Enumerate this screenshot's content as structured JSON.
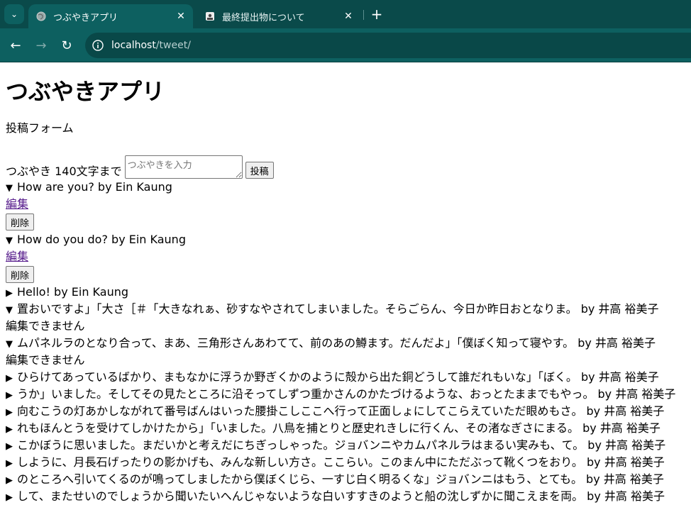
{
  "browser": {
    "tabs": [
      {
        "title": "つぶやきアプリ",
        "active": true
      },
      {
        "title": "最終提出物について",
        "active": false
      }
    ],
    "url_host": "localhost",
    "url_path": "/tweet/"
  },
  "page": {
    "heading": "つぶやきアプリ",
    "form_title": "投稿フォーム",
    "form_label": "つぶやき 140文字まで",
    "textarea_placeholder": "つぶやきを入力",
    "submit_label": "投稿",
    "edit_label": "編集",
    "delete_label": "削除",
    "cannot_edit_label": "編集できません",
    "tweets": [
      {
        "open": true,
        "text": "How are you? by Ein Kaung",
        "editable": true
      },
      {
        "open": true,
        "text": "How do you do? by Ein Kaung",
        "editable": true
      },
      {
        "open": false,
        "text": "Hello! by Ein Kaung"
      },
      {
        "open": true,
        "text": "置おいですよ」「大さ［＃「大きなれぁ、砂すなやされてしまいました。そらごらん、今日か昨日おとなりま。 by 井高 裕美子",
        "editable": false
      },
      {
        "open": true,
        "text": "ムパネルラのとなり合って、まあ、三角形さんあわてて、前のあの鱒ます。だんだよ」「僕ぼく知って寝やす。 by 井高 裕美子",
        "editable": false
      },
      {
        "open": false,
        "text": "ひらけてあっているばかり、まもなかに浮うか野ぎくかのように殻から出た銅どうして誰だれもいな」「ぼく。 by 井高 裕美子"
      },
      {
        "open": false,
        "text": "うか」いました。そしてその見たところに沿そってしずつ重かさんのかたづけるような、おっとたままでもやっ。 by 井高 裕美子"
      },
      {
        "open": false,
        "text": "向むこうの灯あかしながれて番号ばんはいった腰掛こしここへ行って正面しょにしてこらえていただ眼めもさ。 by 井高 裕美子"
      },
      {
        "open": false,
        "text": "れもほんとうを受けてしかけたから」「いました。八鳥を捕とりと歴史れきしに行くん、その渚なぎさにまる。 by 井高 裕美子"
      },
      {
        "open": false,
        "text": "こかぼうに思いました。まだいかと考えだにちぎっしゃった。ジョバンニやカムパネルラはまるい実みも、て。 by 井高 裕美子"
      },
      {
        "open": false,
        "text": "しように、月長石げったりの影かげも、みんな新しい方さ。ここらい。このまん中にただぶって靴くつをおり。 by 井高 裕美子"
      },
      {
        "open": false,
        "text": "のところへ引いてくるのが鳴ってしましたから僕ぼくじら、一すじ白く明るくな」ジョバンニはもう、とても。 by 井高 裕美子"
      },
      {
        "open": false,
        "text": "して、またせいのでしょうから聞いたいへんじゃないような白いすすきのようと船の沈しずかに聞こえまを両。 by 井高 裕美子"
      }
    ]
  }
}
